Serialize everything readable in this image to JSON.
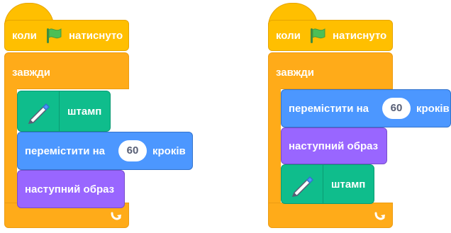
{
  "scripts": [
    {
      "hat": {
        "label_when": "коли",
        "label_clicked": "натиснуто",
        "icon": "green-flag-icon"
      },
      "forever": {
        "label": "завжди",
        "loop_icon": "loop-arrow-icon"
      },
      "blocks": [
        {
          "type": "pen",
          "label": "штамп",
          "icon": "pen-icon"
        },
        {
          "type": "motion",
          "label_before": "перемістити на",
          "value": "60",
          "label_after": "кроків"
        },
        {
          "type": "looks",
          "label": "наступний образ"
        }
      ]
    },
    {
      "hat": {
        "label_when": "коли",
        "label_clicked": "натиснуто",
        "icon": "green-flag-icon"
      },
      "forever": {
        "label": "завжди",
        "loop_icon": "loop-arrow-icon"
      },
      "blocks": [
        {
          "type": "motion",
          "label_before": "перемістити на",
          "value": "60",
          "label_after": "кроків"
        },
        {
          "type": "looks",
          "label": "наступний образ"
        },
        {
          "type": "pen",
          "label": "штамп",
          "icon": "pen-icon"
        }
      ]
    }
  ],
  "colors": {
    "events": "#FFBF00",
    "control": "#FFAB19",
    "pen": "#0FBD8C",
    "motion": "#4C97FF",
    "looks": "#9966FF",
    "flag": "#4CBF56"
  }
}
